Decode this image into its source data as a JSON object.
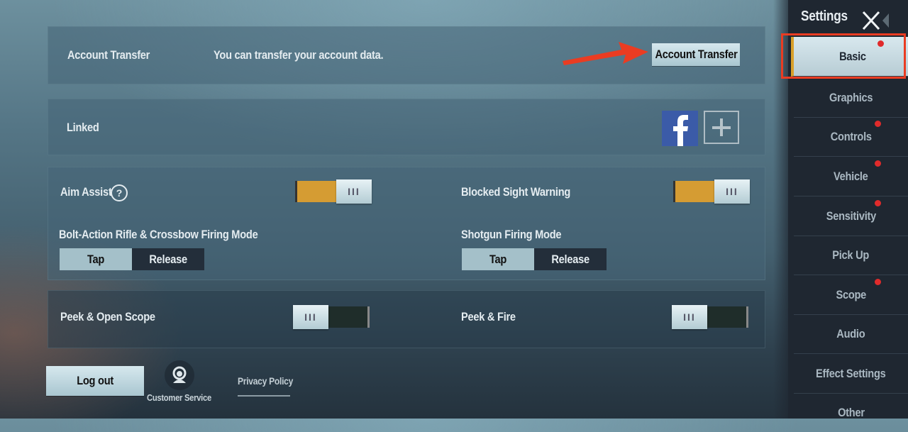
{
  "account_transfer": {
    "label": "Account Transfer",
    "description": "You can transfer your account data.",
    "button_label": "Account Transfer"
  },
  "linked": {
    "label": "Linked",
    "accounts": [
      "facebook-icon",
      "add-icon"
    ]
  },
  "settings": {
    "aim_assist": {
      "label": "Aim Assist",
      "enabled": true
    },
    "blocked_sight_warning": {
      "label": "Blocked Sight Warning",
      "enabled": true
    },
    "bolt_action_mode": {
      "label": "Bolt-Action Rifle & Crossbow Firing Mode",
      "options": [
        "Tap",
        "Release"
      ],
      "selected": "Tap"
    },
    "shotgun_mode": {
      "label": "Shotgun Firing Mode",
      "options": [
        "Tap",
        "Release"
      ],
      "selected": "Tap"
    },
    "peek_open_scope": {
      "label": "Peek & Open Scope",
      "enabled": false
    },
    "peek_fire": {
      "label": "Peek & Fire",
      "enabled": false
    },
    "toggle_grip": "III"
  },
  "footer": {
    "logout_label": "Log out",
    "customer_service_label": "Customer Service",
    "privacy_policy_label": "Privacy Policy"
  },
  "sidebar": {
    "title": "Settings",
    "items": [
      {
        "label": "Basic",
        "active": true,
        "notification": true
      },
      {
        "label": "Graphics",
        "active": false,
        "notification": false
      },
      {
        "label": "Controls",
        "active": false,
        "notification": true
      },
      {
        "label": "Vehicle",
        "active": false,
        "notification": true
      },
      {
        "label": "Sensitivity",
        "active": false,
        "notification": true
      },
      {
        "label": "Pick Up",
        "active": false,
        "notification": false
      },
      {
        "label": "Scope",
        "active": false,
        "notification": true
      },
      {
        "label": "Audio",
        "active": false,
        "notification": false
      },
      {
        "label": "Effect Settings",
        "active": false,
        "notification": false
      },
      {
        "label": "Other",
        "active": false,
        "notification": false
      }
    ]
  },
  "annotation": {
    "arrow_color": "#ea3c22",
    "highlight_color": "#ea3c22"
  }
}
